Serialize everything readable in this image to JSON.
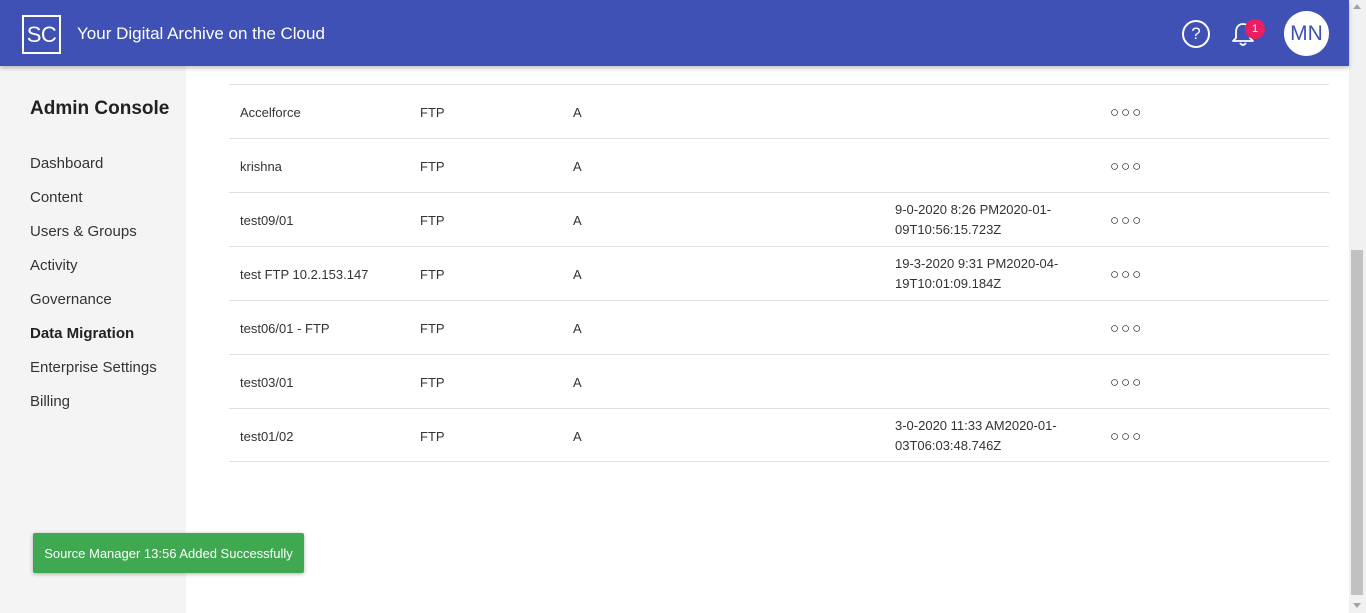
{
  "header": {
    "logo": "SC",
    "title": "Your Digital Archive on the Cloud",
    "help_icon": "?",
    "notification_count": "1",
    "avatar_initials": "MN"
  },
  "sidebar": {
    "title": "Admin Console",
    "items": [
      {
        "label": "Dashboard"
      },
      {
        "label": "Content"
      },
      {
        "label": "Users & Groups"
      },
      {
        "label": "Activity"
      },
      {
        "label": "Governance"
      },
      {
        "label": "Data Migration",
        "active": true
      },
      {
        "label": "Enterprise Settings"
      },
      {
        "label": "Billing"
      }
    ]
  },
  "table": {
    "rows": [
      {
        "name": "Accelforce",
        "type": "FTP",
        "status": "A",
        "date": "",
        "actions": "○○○"
      },
      {
        "name": "krishna",
        "type": "FTP",
        "status": "A",
        "date": "",
        "actions": "○○○"
      },
      {
        "name": "test09/01",
        "type": "FTP",
        "status": "A",
        "date": "9-0-2020 8:26 PM2020-01-09T10:56:15.723Z",
        "actions": "○○○"
      },
      {
        "name": "test FTP 10.2.153.147",
        "type": "FTP",
        "status": "A",
        "date": "19-3-2020 9:31 PM2020-04-19T10:01:09.184Z",
        "actions": "○○○"
      },
      {
        "name": "test06/01 - FTP",
        "type": "FTP",
        "status": "A",
        "date": "",
        "actions": "○○○"
      },
      {
        "name": "test03/01",
        "type": "FTP",
        "status": "A",
        "date": "",
        "actions": "○○○"
      },
      {
        "name": "test01/02",
        "type": "FTP",
        "status": "A",
        "date": "3-0-2020 11:33 AM2020-01-03T06:03:48.746Z",
        "actions": "○○○"
      }
    ]
  },
  "toast": {
    "message": "Source Manager 13:56 Added Successfully"
  },
  "colors": {
    "header_bg": "#3f51b5",
    "badge": "#e91e63",
    "toast_bg": "#3fa850"
  }
}
